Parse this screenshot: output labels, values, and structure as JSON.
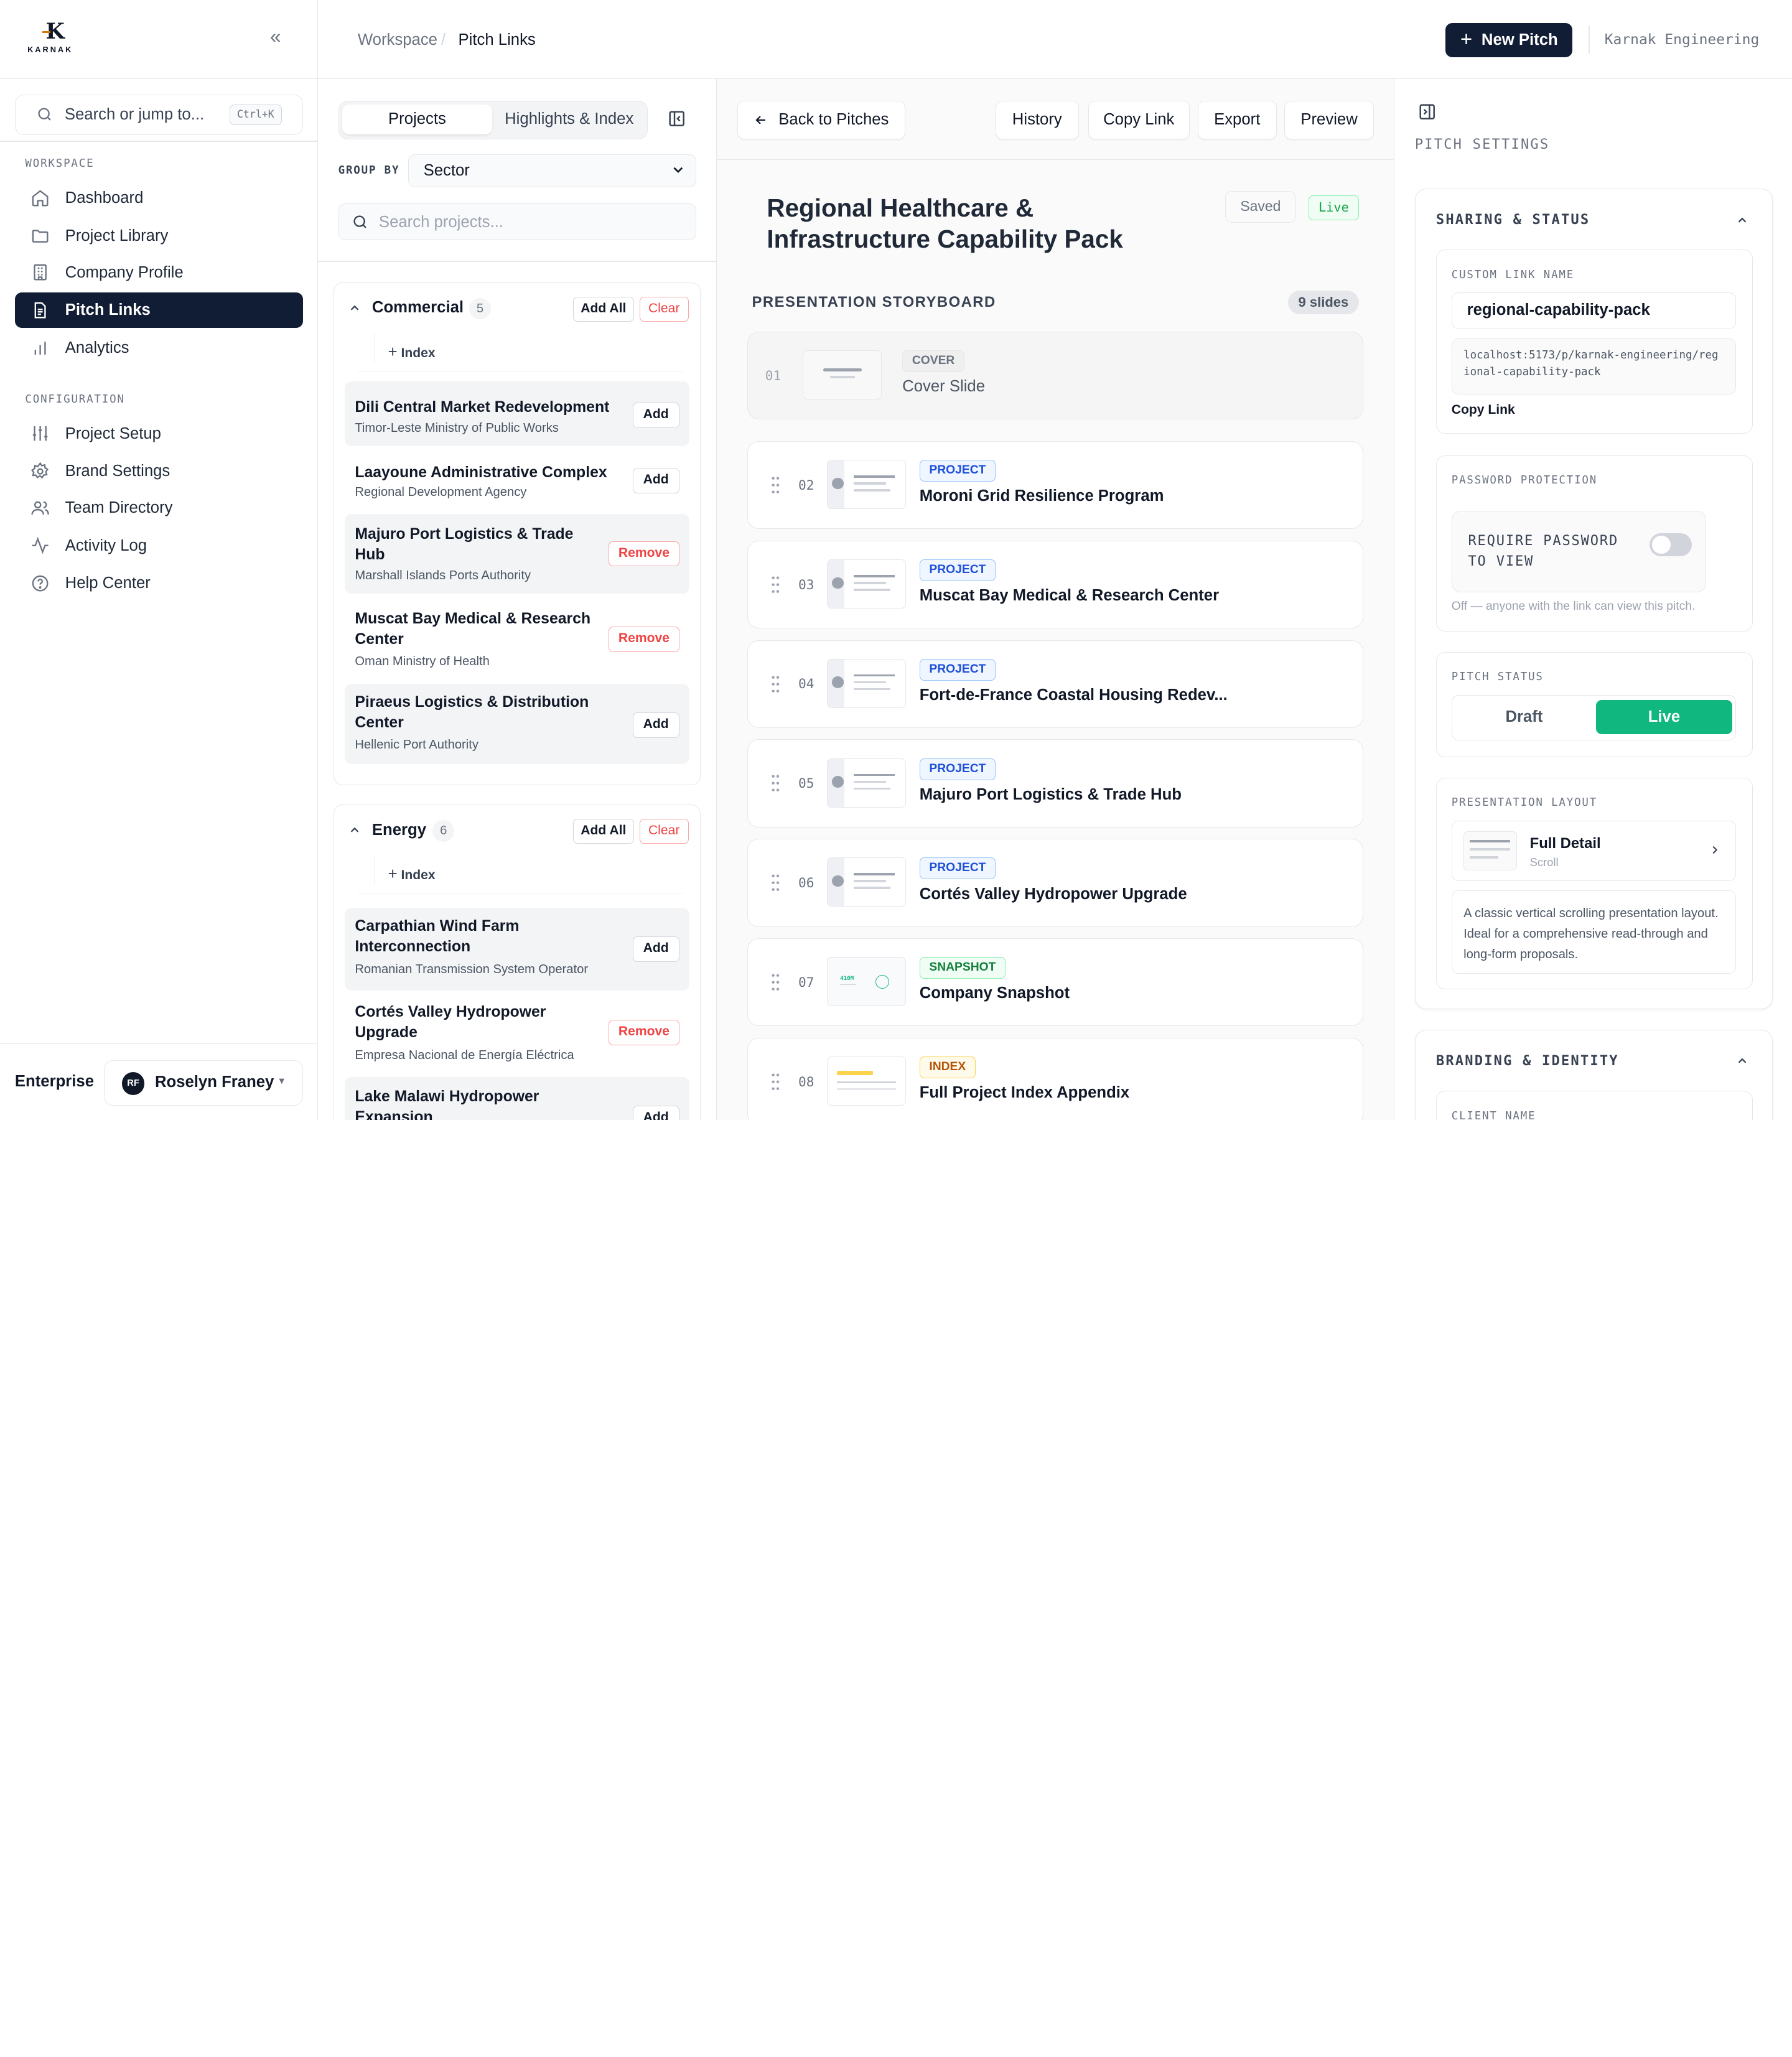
{
  "brand": {
    "logo_letter": "K",
    "logo_text": "KARNAK"
  },
  "sidebar": {
    "search": {
      "placeholder": "Search or jump to...",
      "shortcut": "Ctrl+K"
    },
    "workspace_label": "WORKSPACE",
    "workspace_items": [
      {
        "label": "Dashboard",
        "icon": "home-icon"
      },
      {
        "label": "Project Library",
        "icon": "folder-icon"
      },
      {
        "label": "Company Profile",
        "icon": "building-icon"
      },
      {
        "label": "Pitch Links",
        "icon": "document-icon",
        "active": true
      },
      {
        "label": "Analytics",
        "icon": "bar-chart-icon"
      }
    ],
    "config_label": "CONFIGURATION",
    "config_items": [
      {
        "label": "Project Setup",
        "icon": "sliders-icon"
      },
      {
        "label": "Brand Settings",
        "icon": "gear-icon"
      },
      {
        "label": "Team Directory",
        "icon": "users-icon"
      },
      {
        "label": "Activity Log",
        "icon": "activity-icon"
      },
      {
        "label": "Help Center",
        "icon": "help-icon"
      }
    ],
    "footer": {
      "plan": "Enterprise",
      "user_initials": "RF",
      "user_name": "Roselyn Franey"
    }
  },
  "topbar": {
    "breadcrumb": [
      "Workspace",
      "Pitch Links"
    ],
    "new_pitch_label": "New Pitch",
    "org_name": "Karnak Engineering"
  },
  "projects_panel": {
    "tabs": [
      "Projects",
      "Highlights & Index"
    ],
    "active_tab": 0,
    "group_by_label": "GROUP BY",
    "group_by_value": "Sector",
    "search_placeholder": "Search projects...",
    "add_all_label": "Add All",
    "clear_label": "Clear",
    "index_label": "Index",
    "add_label": "Add",
    "remove_label": "Remove",
    "groups": [
      {
        "name": "Commercial",
        "count": "5",
        "items": [
          {
            "title": "Dili Central Market Redevelopment",
            "client": "Timor-Leste Ministry of Public Works",
            "state": "add"
          },
          {
            "title": "Laayoune Administrative Complex",
            "client": "Regional Development Agency",
            "state": "add"
          },
          {
            "title": "Majuro Port Logistics & Trade Hub",
            "client": "Marshall Islands Ports Authority",
            "state": "remove"
          },
          {
            "title": "Muscat Bay Medical & Research Center",
            "client": "Oman Ministry of Health",
            "state": "remove"
          },
          {
            "title": "Piraeus Logistics & Distribution Center",
            "client": "Hellenic Port Authority",
            "state": "add"
          }
        ]
      },
      {
        "name": "Energy",
        "count": "6",
        "items": [
          {
            "title": "Carpathian Wind Farm Interconnection",
            "client": "Romanian Transmission System Operator",
            "state": "add"
          },
          {
            "title": "Cortés Valley Hydropower Upgrade",
            "client": "Empresa Nacional de Energía Eléctrica",
            "state": "remove"
          },
          {
            "title": "Lake Malawi Hydropower Expansion",
            "client": "",
            "state": "add"
          }
        ]
      }
    ]
  },
  "storyboard": {
    "back_label": "Back to Pitches",
    "actions": [
      "History",
      "Copy Link",
      "Export",
      "Preview"
    ],
    "title": "Regional Healthcare & Infrastructure Capability Pack",
    "saved_label": "Saved",
    "live_label": "Live",
    "section_label": "PRESENTATION STORYBOARD",
    "slide_count": "9 slides",
    "slides": [
      {
        "num": "01",
        "tag": "COVER",
        "title": "Cover Slide",
        "kind": "cover"
      },
      {
        "num": "02",
        "tag": "PROJECT",
        "title": "Moroni Grid Resilience Program",
        "kind": "project"
      },
      {
        "num": "03",
        "tag": "PROJECT",
        "title": "Muscat Bay Medical & Research Center",
        "kind": "project"
      },
      {
        "num": "04",
        "tag": "PROJECT",
        "title": "Fort-de-France Coastal Housing Redev...",
        "kind": "project"
      },
      {
        "num": "05",
        "tag": "PROJECT",
        "title": "Majuro Port Logistics & Trade Hub",
        "kind": "project"
      },
      {
        "num": "06",
        "tag": "PROJECT",
        "title": "Cortés Valley Hydropower Upgrade",
        "kind": "project"
      },
      {
        "num": "07",
        "tag": "SNAPSHOT",
        "title": "Company Snapshot",
        "kind": "snapshot",
        "thumb_text": "410M"
      },
      {
        "num": "08",
        "tag": "INDEX",
        "title": "Full Project Index Appendix",
        "kind": "index"
      }
    ]
  },
  "settings": {
    "title": "PITCH SETTINGS",
    "sharing": {
      "heading": "SHARING & STATUS",
      "custom_link_label": "CUSTOM LINK NAME",
      "custom_link_value": "regional-capability-pack",
      "url": "localhost:5173/p/karnak-engineering/regional-capability-pack",
      "copy_label": "Copy Link",
      "password_label": "PASSWORD PROTECTION",
      "password_toggle_label": "REQUIRE PASSWORD TO VIEW",
      "password_note": "Off — anyone with the link can view this pitch.",
      "status_label": "PITCH STATUS",
      "status_options": [
        "Draft",
        "Live"
      ],
      "status_value": "Live",
      "layout_label": "PRESENTATION LAYOUT",
      "layout_name": "Full Detail",
      "layout_sub": "Scroll",
      "layout_desc": "A classic vertical scrolling presentation layout. Ideal for a comprehensive read-through and long-form proposals."
    },
    "branding": {
      "heading": "BRANDING & IDENTITY",
      "client_name_label": "CLIENT NAME"
    }
  },
  "colors": {
    "navy": "#111d35",
    "live_green": "#10b77f",
    "danger_red": "#ef4444",
    "project_blue": "#1d4ed8"
  }
}
